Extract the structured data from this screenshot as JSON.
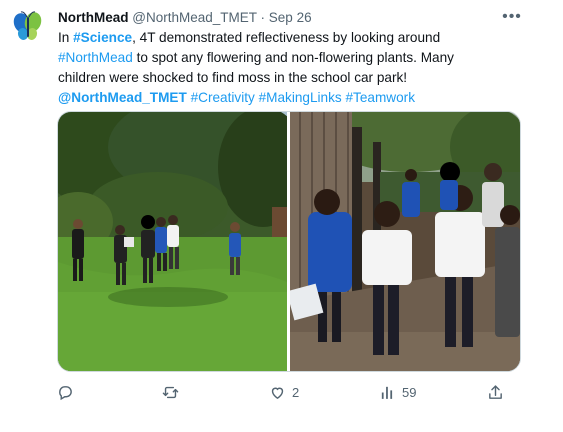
{
  "author": {
    "name": "NorthMead",
    "handle": "@NorthMead_TMET",
    "separator": "·",
    "date": "Sep 26"
  },
  "more_icon": "more-horizontal-icon",
  "tweet": {
    "l1": {
      "a": "In ",
      "tag": "#Science",
      "b": ", 4T demonstrated reflectiveness by looking around"
    },
    "l2": {
      "tag": "#NorthMead",
      "b": " to spot any flowering and non-flowering plants.  Many"
    },
    "l3": {
      "a": "children were shocked to find moss in the school car park!"
    },
    "l4": {
      "mention": "@NorthMead_TMET",
      "tag1": "#Creativity",
      "tag2": "#MakingLinks",
      "tag3": "#Teamwork"
    }
  },
  "actions": {
    "reply": {
      "icon": "reply-icon",
      "count": ""
    },
    "retweet": {
      "icon": "retweet-icon",
      "count": ""
    },
    "like": {
      "icon": "heart-icon",
      "count": "2"
    },
    "views": {
      "icon": "views-chart-icon",
      "count": "59"
    },
    "share": {
      "icon": "share-icon"
    }
  },
  "colors": {
    "link": "#1d9bf0",
    "text": "#0f1419",
    "secondary": "#536471",
    "border": "#cfd9de"
  }
}
